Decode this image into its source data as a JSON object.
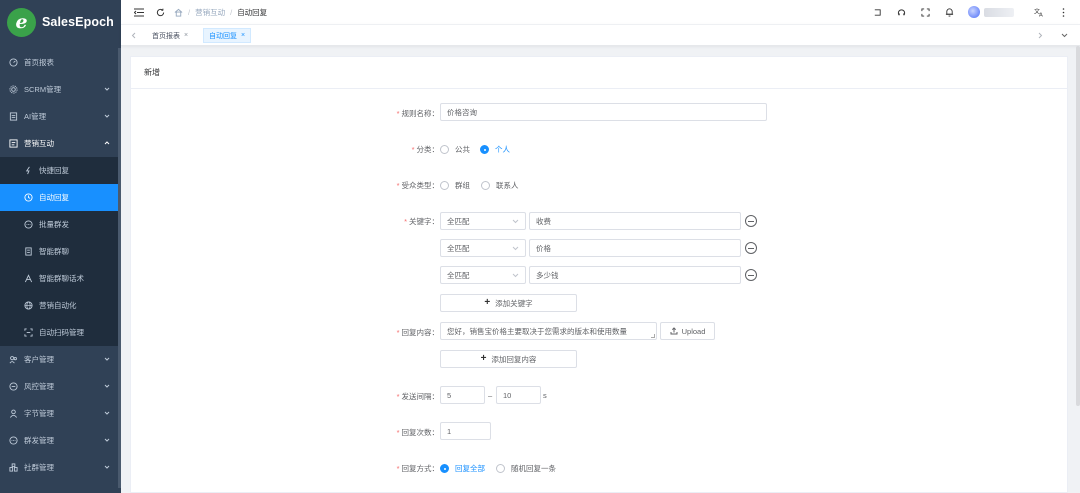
{
  "app": {
    "logo_letter": "e",
    "logo_text": "SalesEpoch"
  },
  "sidebar": {
    "items": [
      {
        "label": "首页报表",
        "icon": "gauge-icon"
      },
      {
        "label": "SCRM管理",
        "icon": "gear-icon",
        "has_chevron": true
      },
      {
        "label": "AI管理",
        "icon": "ai-box-icon",
        "has_chevron": true
      },
      {
        "label": "营销互动",
        "icon": "marketing-icon",
        "has_chevron": true,
        "expanded": true
      }
    ],
    "sub_items": [
      {
        "label": "快捷回复",
        "icon": "flash-icon"
      },
      {
        "label": "自动回复",
        "icon": "clock-reply-icon",
        "active": true
      },
      {
        "label": "批量群发",
        "icon": "chat-bubble-icon"
      },
      {
        "label": "智能群聊",
        "icon": "group-chat-icon"
      },
      {
        "label": "智能群聊话术",
        "icon": "person-tag-icon"
      },
      {
        "label": "营销自动化",
        "icon": "globe-icon"
      },
      {
        "label": "自动扫码管理",
        "icon": "scan-icon"
      }
    ],
    "items_after": [
      {
        "label": "客户管理",
        "icon": "customer-icon"
      },
      {
        "label": "风控管理",
        "icon": "shield-icon"
      },
      {
        "label": "字节管理",
        "icon": "user-icon"
      },
      {
        "label": "群发管理",
        "icon": "broadcast-icon"
      },
      {
        "label": "社群管理",
        "icon": "community-icon"
      }
    ]
  },
  "header": {
    "breadcrumb": {
      "home_icon": "home-icon",
      "parent": "营销互动",
      "current": "自动回复",
      "sep": "/"
    },
    "right_icons": [
      "exit-fullscreen-icon",
      "github-icon",
      "fullscreen-icon",
      "bell-icon"
    ]
  },
  "tags": [
    {
      "label": "首页报表",
      "close": "×"
    },
    {
      "label": "自动回复",
      "close": "×",
      "active": true
    }
  ],
  "card": {
    "title": "新增"
  },
  "form": {
    "rule_name": {
      "label": "规则名称",
      "value": "价格咨询"
    },
    "category": {
      "label": "分类",
      "options": [
        "公共",
        "个人"
      ],
      "selected": "个人"
    },
    "audience": {
      "label": "受众类型",
      "options": [
        "群组",
        "联系人"
      ],
      "selected": ""
    },
    "keywords": {
      "label": "关键字",
      "rows": [
        {
          "match": "全匹配",
          "keyword": "收费"
        },
        {
          "match": "全匹配",
          "keyword": "价格"
        },
        {
          "match": "全匹配",
          "keyword": "多少钱"
        }
      ],
      "add_label": "添加关键字"
    },
    "reply": {
      "label": "回复内容",
      "value": "您好，销售宝价格主要取决于您需求的版本和使用数量",
      "upload_label": "Upload",
      "add_label": "添加回复内容"
    },
    "interval": {
      "label": "发送间隔",
      "min": "5",
      "dash": "–",
      "max": "10",
      "unit": "s"
    },
    "count": {
      "label": "回复次数",
      "value": "1"
    },
    "mode": {
      "label": "回复方式",
      "options": [
        "回复全部",
        "随机回复一条"
      ],
      "selected": "回复全部"
    }
  },
  "colors": {
    "sidebar_bg": "#304156",
    "accent": "#1890ff",
    "required": "#f56c6c"
  }
}
